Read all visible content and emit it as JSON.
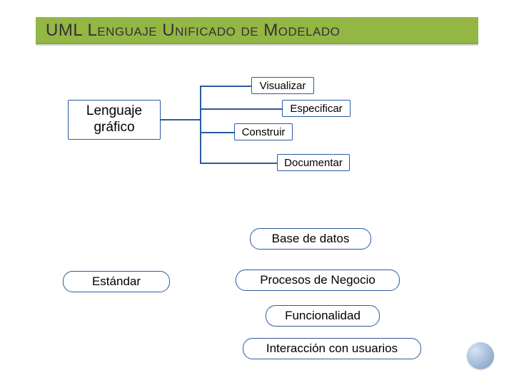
{
  "title": "UML Lenguaje Unificado de Modelado",
  "mainBox": "Lenguaje gráfico",
  "capabilities": [
    "Visualizar",
    "Especificar",
    "Construir",
    "Documentar"
  ],
  "standard": "Estándar",
  "applications": [
    "Base de datos",
    "Procesos de Negocio",
    "Funcionalidad",
    "Interacción con usuarios"
  ]
}
